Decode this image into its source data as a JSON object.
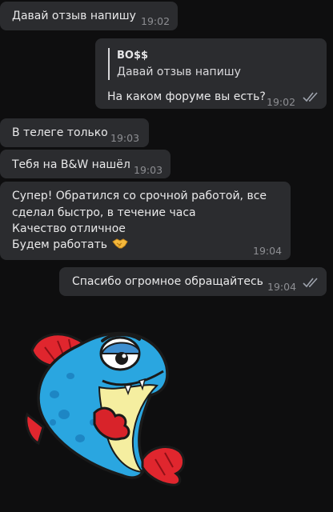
{
  "messages": [
    {
      "text": "Давай отзыв напишу",
      "time": "19:02"
    },
    {
      "reply_name": "BO$$",
      "reply_text": "Давай отзыв напишу",
      "text": "На каком форуме вы есть?",
      "time": "19:02",
      "status": "read"
    },
    {
      "text": "В телеге только",
      "time": "19:03"
    },
    {
      "text": "Тебя на B&W нашёл",
      "time": "19:03"
    },
    {
      "lines": [
        "Супер! Обратился со срочной работой, все",
        "сделал быстро, в течение часа",
        "Качество отличное",
        "Будем работать"
      ],
      "emoji": "handshake",
      "time": "19:04"
    },
    {
      "text": "Спасибо огромное обращайтесь",
      "time": "19:04",
      "status": "read"
    }
  ],
  "sticker": {
    "icon": "blue-fish-sticker"
  },
  "colors": {
    "background": "#0e0e0f",
    "bubble": "#2b2c2f",
    "time": "#8d8e92",
    "checks": "#9ea3ad"
  }
}
